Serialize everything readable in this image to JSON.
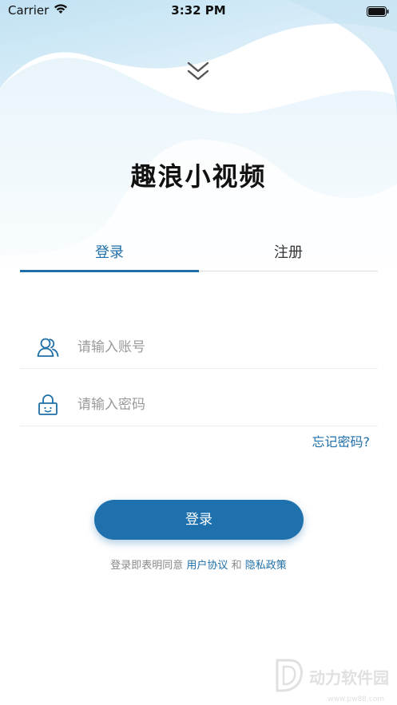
{
  "status_bar": {
    "carrier": "Carrier",
    "time": "3:32 PM"
  },
  "app": {
    "title": "趣浪小视频"
  },
  "tabs": [
    {
      "label": "登录",
      "active": true
    },
    {
      "label": "注册",
      "active": false
    }
  ],
  "form": {
    "account_placeholder": "请输入账号",
    "password_placeholder": "请输入密码",
    "forgot_label": "忘记密码?"
  },
  "login_button": {
    "label": "登录"
  },
  "agreement": {
    "prefix": "登录即表明同意",
    "user_agreement": "用户协议",
    "and": "和",
    "privacy_policy": "隐私政策"
  },
  "watermark": {
    "text": "动力软件园",
    "sub": "www.pw88.com"
  },
  "colors": {
    "accent": "#1f71ad",
    "link": "#1f6fa8",
    "background_wave": "#cfe7f5"
  }
}
